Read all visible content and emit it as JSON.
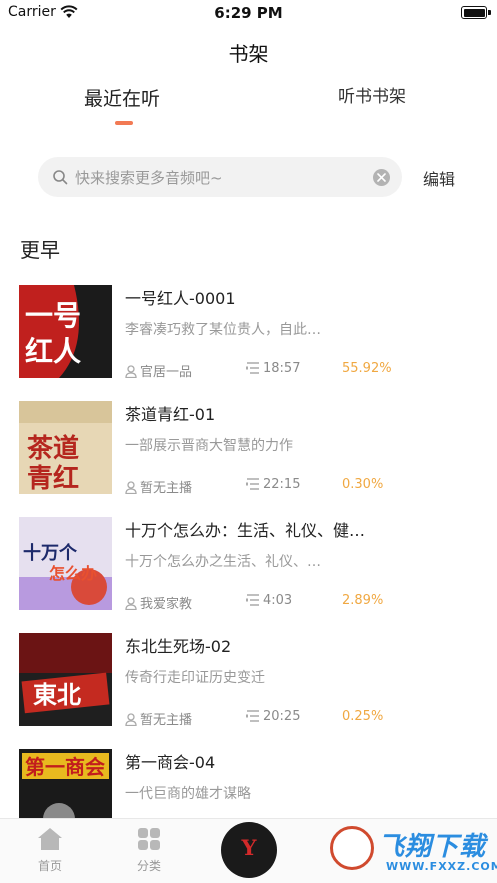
{
  "status_bar": {
    "carrier": "Carrier",
    "time": "6:29 PM"
  },
  "nav": {
    "title": "书架"
  },
  "tabs": {
    "recent": "最近在听",
    "shelf": "听书书架"
  },
  "search": {
    "placeholder": "快来搜索更多音频吧~",
    "edit_label": "编辑"
  },
  "section": {
    "title": "更早"
  },
  "items": [
    {
      "title": "一号红人-0001",
      "desc": "李睿凑巧救了某位贵人，自此…",
      "host": "官居一品",
      "duration": "18:57",
      "progress": "55.92%",
      "cover_text": "一号红人"
    },
    {
      "title": "茶道青红-01",
      "desc": "一部展示晋商大智慧的力作",
      "host": "暂无主播",
      "duration": "22:15",
      "progress": "0.30%",
      "cover_text": "茶道青红"
    },
    {
      "title": "十万个怎么办：生活、礼仪、健…",
      "desc": "十万个怎么办之生活、礼仪、…",
      "host": "我爱家教",
      "duration": "4:03",
      "progress": "2.89%",
      "cover_text": "十万个怎么办"
    },
    {
      "title": "东北生死场-02",
      "desc": "传奇行走印证历史变迁",
      "host": "暂无主播",
      "duration": "20:25",
      "progress": "0.25%",
      "cover_text": "東北生死場"
    },
    {
      "title": "第一商会-04",
      "desc": "一代巨商的雄才谋略",
      "host": "",
      "duration": "",
      "progress": "",
      "cover_text": "第一商会"
    }
  ],
  "tab_bar": {
    "home": "首页",
    "category": "分类"
  },
  "watermark": {
    "text": "飞翔下载",
    "url": "WWW.FXXZ.COM"
  },
  "colors": {
    "accent": "#f27a54",
    "progress": "#f0a842",
    "placeholder": "#999999"
  }
}
